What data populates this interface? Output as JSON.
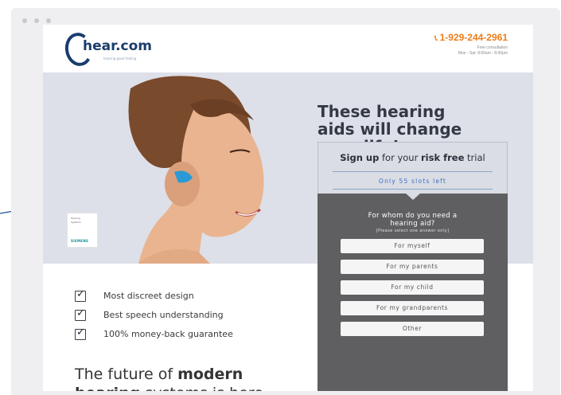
{
  "header": {
    "logo_text": "hear.com",
    "logo_tagline": "hearing good feeling",
    "phone": "1-929-244-2961",
    "consult_line1": "Free consultation",
    "consult_line2": "Mon - Sat: 8:00am - 8:00pm"
  },
  "hero": {
    "badge_line1": "Hearing",
    "badge_line2": "Systems",
    "badge_brand": "SIEMENS",
    "headline_line1": "These hearing",
    "headline_line2": "aids will change",
    "headline_line3": "your life!"
  },
  "form": {
    "signup_bold1": "Sign up",
    "signup_mid": " for your ",
    "signup_bold2": "risk free",
    "signup_end": " trial",
    "slots": "Only 55 slots left",
    "question_line1": "For whom do you need a",
    "question_line2": "hearing aid?",
    "hint": "[Please select one answer only]",
    "options": [
      "For myself",
      "For my parents",
      "For my child",
      "For my grandparents",
      "Other"
    ]
  },
  "features": [
    "Most discreet design",
    "Best speech understanding",
    "100% money-back guarantee"
  ],
  "future": {
    "part1": "The future of ",
    "bold1": "modern",
    "bold2": "hearing",
    "part2": " systems is here"
  },
  "colors": {
    "accent_orange": "#ef7d1a",
    "brand_navy": "#1c3d6d",
    "slots_blue": "#3b6fbf",
    "form_dark": "#5f5f61",
    "hero_bg": "#dde0e8"
  },
  "icons": [
    "phone-icon",
    "checkbox-icon",
    "arrow-icon"
  ]
}
